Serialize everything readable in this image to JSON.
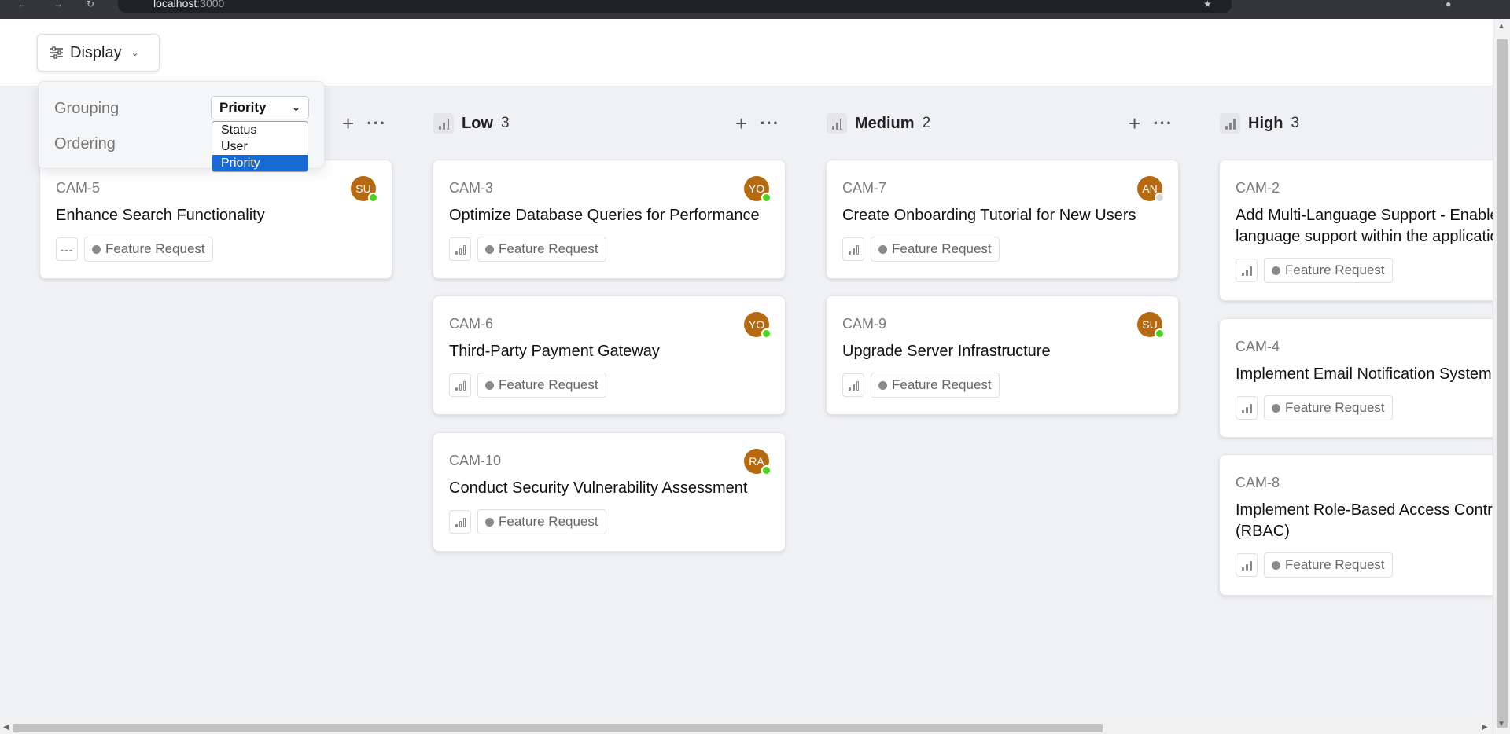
{
  "browser": {
    "url_host": "localhost",
    "url_port": ":3000"
  },
  "toolbar": {
    "display_label": "Display"
  },
  "display_menu": {
    "grouping_label": "Grouping",
    "ordering_label": "Ordering",
    "grouping_value": "Priority",
    "options": [
      "Status",
      "User",
      "Priority"
    ],
    "selected_option": "Priority"
  },
  "columns": [
    {
      "title": "Low",
      "count": "3",
      "cards": [
        {
          "id": "CAM-3",
          "title": "Optimize Database Queries for Performance",
          "avatar": "YO",
          "online": true,
          "tag": "Feature Request"
        },
        {
          "id": "CAM-6",
          "title": "Third-Party Payment Gateway",
          "avatar": "YO",
          "online": true,
          "tag": "Feature Request"
        },
        {
          "id": "CAM-10",
          "title": "Conduct Security Vulnerability Assessment",
          "avatar": "RA",
          "online": true,
          "tag": "Feature Request"
        }
      ]
    },
    {
      "title": "Medium",
      "count": "2",
      "cards": [
        {
          "id": "CAM-7",
          "title": "Create Onboarding Tutorial for New Users",
          "avatar": "AN",
          "online": false,
          "tag": "Feature Request"
        },
        {
          "id": "CAM-9",
          "title": "Upgrade Server Infrastructure",
          "avatar": "SU",
          "online": true,
          "tag": "Feature Request"
        }
      ]
    },
    {
      "title": "High",
      "count": "3",
      "cards": [
        {
          "id": "CAM-2",
          "title": "Add Multi-Language Support - Enable multi-language support within the application.",
          "tag": "Feature Request"
        },
        {
          "id": "CAM-4",
          "title": "Implement Email Notification System",
          "tag": "Feature Request"
        },
        {
          "id": "CAM-8",
          "title": "Implement Role-Based Access Control (RBAC)",
          "tag": "Feature Request"
        }
      ]
    }
  ],
  "no_priority_cards": [
    {
      "id": "CAM-5",
      "title": "Enhance Search Functionality",
      "avatar": "SU",
      "online": true,
      "tag": "Feature Request"
    }
  ],
  "colors": {
    "avatar": "#b56a12",
    "online": "#4cd322",
    "offline": "#d6d6d6",
    "selected_option": "#1a6ad6"
  },
  "icons": {
    "display": "sliders-icon",
    "chevron": "chevron-down-icon",
    "priority_low": "signal-low-icon",
    "priority_medium": "signal-medium-icon",
    "priority_high": "signal-high-icon",
    "no_priority": "dashes-icon"
  }
}
